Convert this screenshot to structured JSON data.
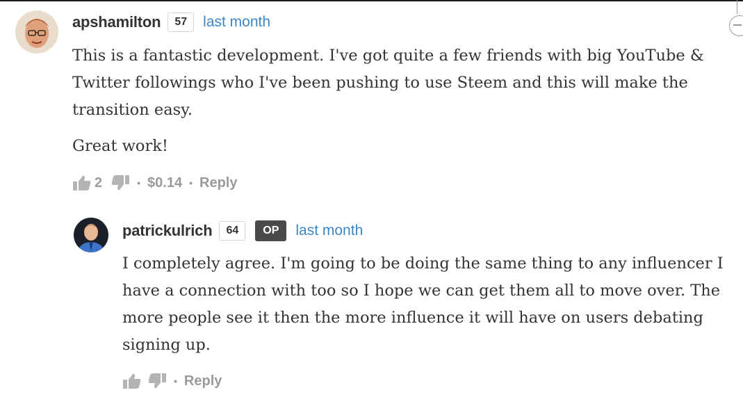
{
  "comments": [
    {
      "author": "apshamilton",
      "reputation": "57",
      "time": "last month",
      "paragraphs": [
        "This is a fantastic development. I've got quite a few friends with big YouTube & Twitter followings who I've been pushing to use Steem and this will make the transition easy.",
        "Great work!"
      ],
      "votes": "2",
      "payout": "$0.14",
      "reply_label": "Reply"
    },
    {
      "author": "patrickulrich",
      "reputation": "64",
      "badge": "OP",
      "time": "last month",
      "paragraphs": [
        "I completely agree. I'm going to be doing the same thing to any influencer I have a connection with too so I hope we can get them all to move over. The more people see it then the more influence it will have on users debating signing up."
      ],
      "reply_label": "Reply"
    }
  ],
  "separator": "•",
  "icons": [
    "thumbs-up-icon",
    "thumbs-down-icon",
    "collapse-icon"
  ],
  "colors": {
    "link": "#3b86c4",
    "text": "#333333",
    "muted": "#9a9a9a",
    "op_badge": "#4a4a4a"
  }
}
